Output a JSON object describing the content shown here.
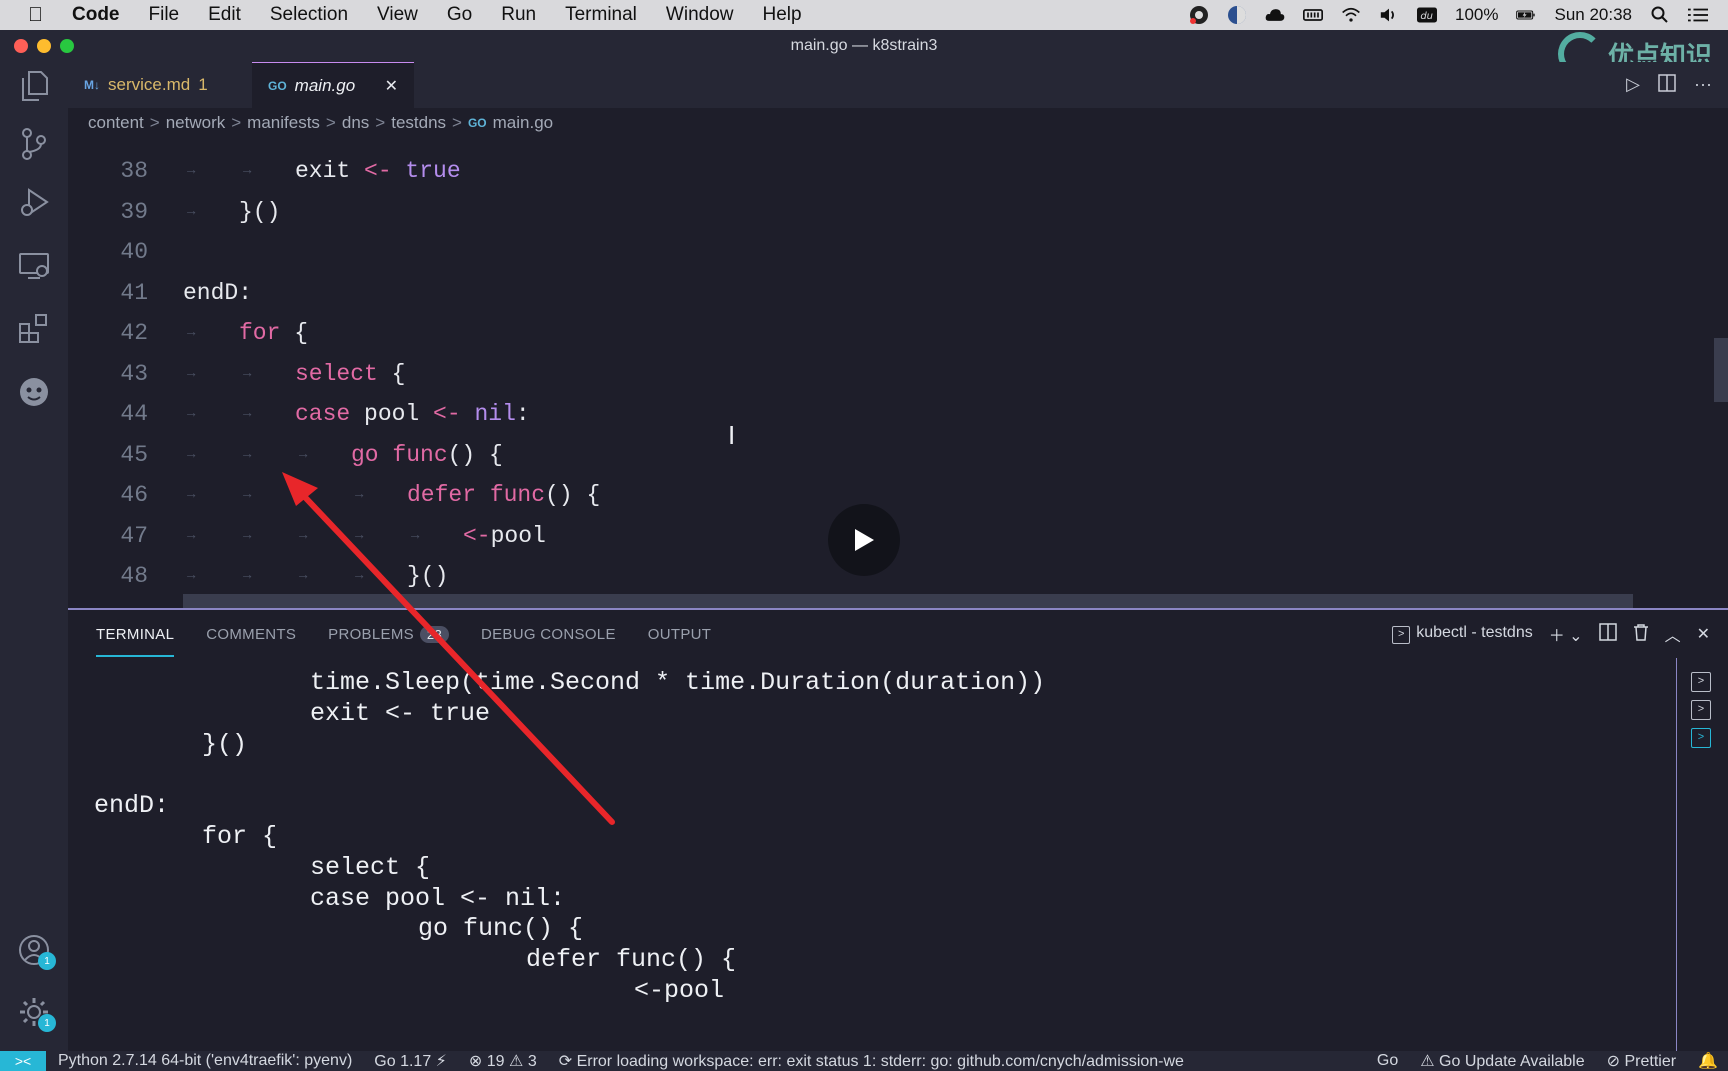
{
  "menubar": {
    "items": [
      "Code",
      "File",
      "Edit",
      "Selection",
      "View",
      "Go",
      "Run",
      "Terminal",
      "Window",
      "Help"
    ],
    "battery": "100%",
    "clock": "Sun 20:38"
  },
  "window": {
    "title": "main.go — k8strain3"
  },
  "watermark": {
    "text": "优点知识"
  },
  "tabs": [
    {
      "label": "service.md",
      "badge": "1",
      "icon": "markdown-icon",
      "active": false
    },
    {
      "label": "main.go",
      "icon": "go-file-icon",
      "active": true
    }
  ],
  "breadcrumb": [
    "content",
    "network",
    "manifests",
    "dns",
    "testdns",
    "main.go"
  ],
  "editor": {
    "lines": [
      {
        "num": "38",
        "indent": 2,
        "tokens": [
          [
            "id",
            "exit "
          ],
          [
            "op",
            "<-"
          ],
          [
            "bool",
            " true"
          ]
        ]
      },
      {
        "num": "39",
        "indent": 1,
        "tokens": [
          [
            "id",
            "}()"
          ]
        ]
      },
      {
        "num": "40",
        "indent": 0,
        "tokens": []
      },
      {
        "num": "41",
        "indent": 0,
        "tokens": [
          [
            "lbl",
            "endD:"
          ]
        ]
      },
      {
        "num": "42",
        "indent": 1,
        "tokens": [
          [
            "kw",
            "for"
          ],
          [
            "id",
            " {"
          ]
        ]
      },
      {
        "num": "43",
        "indent": 2,
        "tokens": [
          [
            "kw",
            "select"
          ],
          [
            "id",
            " {"
          ]
        ]
      },
      {
        "num": "44",
        "indent": 2,
        "tokens": [
          [
            "kw",
            "case"
          ],
          [
            "id",
            " pool "
          ],
          [
            "op",
            "<-"
          ],
          [
            "bool",
            " nil"
          ],
          [
            "id",
            ":"
          ]
        ]
      },
      {
        "num": "45",
        "indent": 3,
        "tokens": [
          [
            "kw",
            "go"
          ],
          [
            "kw",
            " func"
          ],
          [
            "id",
            "() {"
          ]
        ]
      },
      {
        "num": "46",
        "indent": 4,
        "tokens": [
          [
            "kw",
            "defer"
          ],
          [
            "kw",
            " func"
          ],
          [
            "id",
            "() {"
          ]
        ]
      },
      {
        "num": "47",
        "indent": 5,
        "tokens": [
          [
            "op",
            "<-"
          ],
          [
            "id",
            "pool"
          ]
        ]
      },
      {
        "num": "48",
        "indent": 4,
        "tokens": [
          [
            "id",
            "}()"
          ]
        ]
      }
    ]
  },
  "panel": {
    "tabs": [
      {
        "label": "TERMINAL",
        "active": true
      },
      {
        "label": "COMMENTS"
      },
      {
        "label": "PROBLEMS",
        "badge": "23"
      },
      {
        "label": "DEBUG CONSOLE"
      },
      {
        "label": "OUTPUT"
      }
    ],
    "terminal_name": "kubectl - testdns",
    "terminal_lines": [
      {
        "indent": 2,
        "text": "time.Sleep(time.Second * time.Duration(duration))"
      },
      {
        "indent": 2,
        "text": "exit <- true"
      },
      {
        "indent": 1,
        "text": "}()"
      },
      {
        "indent": 0,
        "text": ""
      },
      {
        "indent": 0,
        "text": "endD:"
      },
      {
        "indent": 1,
        "text": "for {"
      },
      {
        "indent": 2,
        "text": "select {"
      },
      {
        "indent": 2,
        "text": "case pool <- nil:"
      },
      {
        "indent": 3,
        "text": "go func() {"
      },
      {
        "indent": 4,
        "text": "defer func() {"
      },
      {
        "indent": 5,
        "text": "<-pool"
      }
    ]
  },
  "statusbar": {
    "python": "Python 2.7.14 64-bit ('env4traefik': pyenv)",
    "go_version": "Go 1.17",
    "errors": "19",
    "warnings": "3",
    "message": "Error loading workspace: err: exit status 1: stderr: go: github.com/cnych/admission-we",
    "language": "Go",
    "go_update": "Go Update Available",
    "prettier": "Prettier"
  },
  "colors": {
    "accent": "#27b7d6",
    "keyword": "#e16aa4",
    "bool": "#b48ded",
    "annotation_arrow": "#e8262a"
  }
}
